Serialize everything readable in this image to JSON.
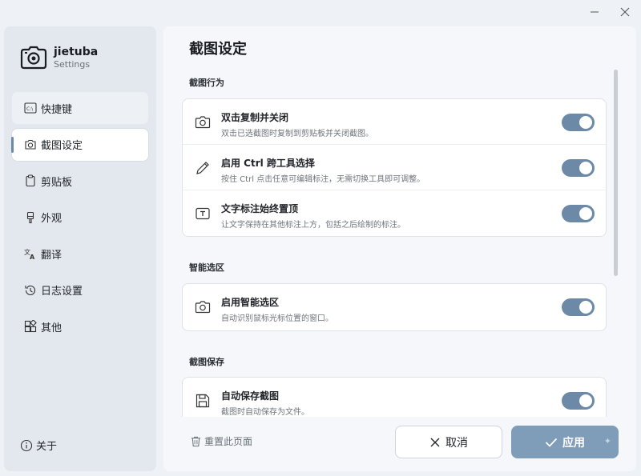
{
  "window": {
    "minimize_icon": "minimize-icon",
    "close_icon": "close-icon"
  },
  "brand": {
    "name": "jietuba",
    "subtitle": "Settings",
    "logo_icon": "camera-logo-icon"
  },
  "sidebar": {
    "items": [
      {
        "label": "快捷键",
        "icon": "keyboard-shortcut-icon"
      },
      {
        "label": "截图设定",
        "icon": "camera-icon"
      },
      {
        "label": "剪贴板",
        "icon": "clipboard-icon"
      },
      {
        "label": "外观",
        "icon": "brush-icon"
      },
      {
        "label": "翻译",
        "icon": "translate-icon"
      },
      {
        "label": "日志设置",
        "icon": "history-icon"
      },
      {
        "label": "其他",
        "icon": "apps-icon"
      }
    ],
    "active_index": 1,
    "about_label": "关于"
  },
  "main": {
    "title": "截图设定",
    "sections": [
      {
        "title": "截图行为",
        "rows": [
          {
            "title": "双击复制并关闭",
            "desc": "双击已选截图时复制到剪贴板并关闭截图。",
            "on": true,
            "icon": "camera-icon"
          },
          {
            "title": "启用 Ctrl 跨工具选择",
            "desc": "按住 Ctrl 点击任意可编辑标注，无需切换工具即可调整。",
            "on": true,
            "icon": "pencil-icon"
          },
          {
            "title": "文字标注始终置顶",
            "desc": "让文字保持在其他标注上方，包括之后绘制的标注。",
            "on": true,
            "icon": "text-box-icon"
          }
        ]
      },
      {
        "title": "智能选区",
        "rows": [
          {
            "title": "启用智能选区",
            "desc": "自动识别鼠标光标位置的窗口。",
            "on": true,
            "icon": "camera-icon"
          }
        ]
      },
      {
        "title": "截图保存",
        "rows": [
          {
            "title": "自动保存截图",
            "desc": "截图时自动保存为文件。",
            "on": true,
            "icon": "save-icon"
          }
        ]
      }
    ]
  },
  "footer": {
    "reset_label": "重置此页面",
    "cancel_label": "取消",
    "apply_label": "应用"
  },
  "colors": {
    "accent": "#6c8aa7",
    "apply_button": "#7f9cb8",
    "sidebar_bg": "#e3e8ee"
  }
}
